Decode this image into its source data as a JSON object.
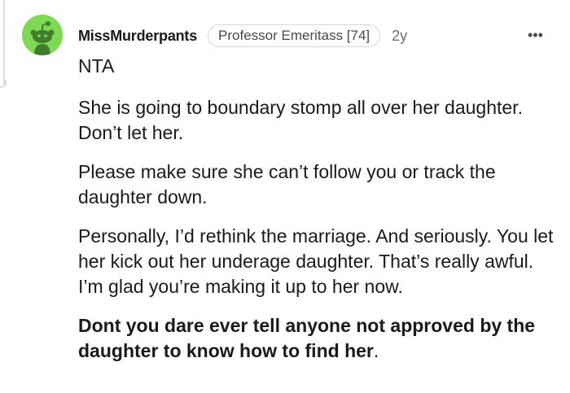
{
  "comment": {
    "username": "MissMurderpants",
    "flair": "Professor Emeritass [74]",
    "age": "2y",
    "more_label": "•••",
    "body": {
      "line1": "NTA",
      "para1": "She is going to boundary stomp all over her daughter. Don’t let her.",
      "para2": "Please make sure she can’t follow you or track the daughter down.",
      "para3": "Personally, I’d rethink the marriage. And seriously. You let her kick out her underage daughter. That’s really awful. I’m glad you’re making it up to her now.",
      "para4_bold": "Dont you dare ever tell anyone not approved by the daughter to know how to find her",
      "para4_end": "."
    }
  },
  "colors": {
    "avatar_bg": "#7ed957",
    "snoo_body": "#3f7f2a",
    "text": "#1a1a1b",
    "muted": "#6f6f6f"
  },
  "icons": {
    "avatar": "reddit-snoo-avatar-icon",
    "more": "more-options-icon"
  }
}
